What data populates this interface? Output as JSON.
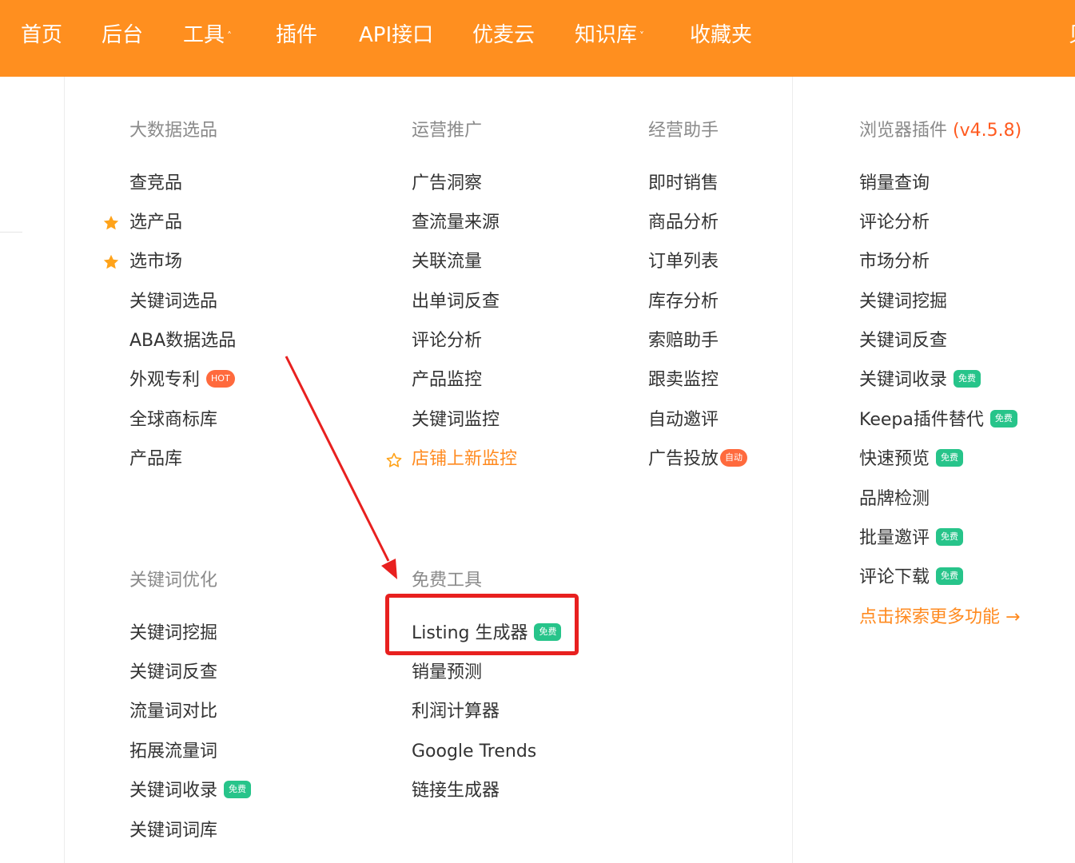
{
  "nav": {
    "home": "首页",
    "backend": "后台",
    "tools": "工具",
    "plugins": "插件",
    "api": "API接口",
    "cloud": "优麦云",
    "knowledge": "知识库",
    "favorites": "收藏夹",
    "edge_char": "贝"
  },
  "bigdata": {
    "heading": "大数据选品",
    "items": [
      "查竞品",
      "选产品",
      "选市场",
      "关键词选品",
      "ABA数据选品",
      "外观专利",
      "全球商标库",
      "产品库"
    ]
  },
  "operations": {
    "heading": "运营推广",
    "items": [
      "广告洞察",
      "查流量来源",
      "关联流量",
      "出单词反查",
      "评论分析",
      "产品监控",
      "关键词监控",
      "店铺上新监控"
    ]
  },
  "business": {
    "heading": "经营助手",
    "items": [
      "即时销售",
      "商品分析",
      "订单列表",
      "库存分析",
      "索赔助手",
      "跟卖监控",
      "自动邀评",
      "广告投放"
    ]
  },
  "browser_plugin": {
    "heading": "浏览器插件",
    "version": "(v4.5.8)",
    "items": [
      "销量查询",
      "评论分析",
      "市场分析",
      "关键词挖掘",
      "关键词反查",
      "关键词收录",
      "Keepa插件替代",
      "快速预览",
      "品牌检测",
      "批量邀评",
      "评论下载"
    ],
    "explore": "点击探索更多功能 →"
  },
  "keyword_opt": {
    "heading": "关键词优化",
    "items": [
      "关键词挖掘",
      "关键词反查",
      "流量词对比",
      "拓展流量词",
      "关键词收录",
      "关键词词库"
    ]
  },
  "free_tools": {
    "heading": "免费工具",
    "items": [
      "Listing 生成器",
      "销量预测",
      "利润计算器",
      "Google Trends",
      "链接生成器"
    ]
  },
  "badges": {
    "free": "免费",
    "hot": "HOT",
    "auto": "自动"
  },
  "colors": {
    "topbar": "#ff8f1f",
    "accent": "#ff8a1f",
    "free_badge": "#27c48a",
    "hot_badge": "#ff6a3d",
    "annotation": "#e8201f"
  }
}
